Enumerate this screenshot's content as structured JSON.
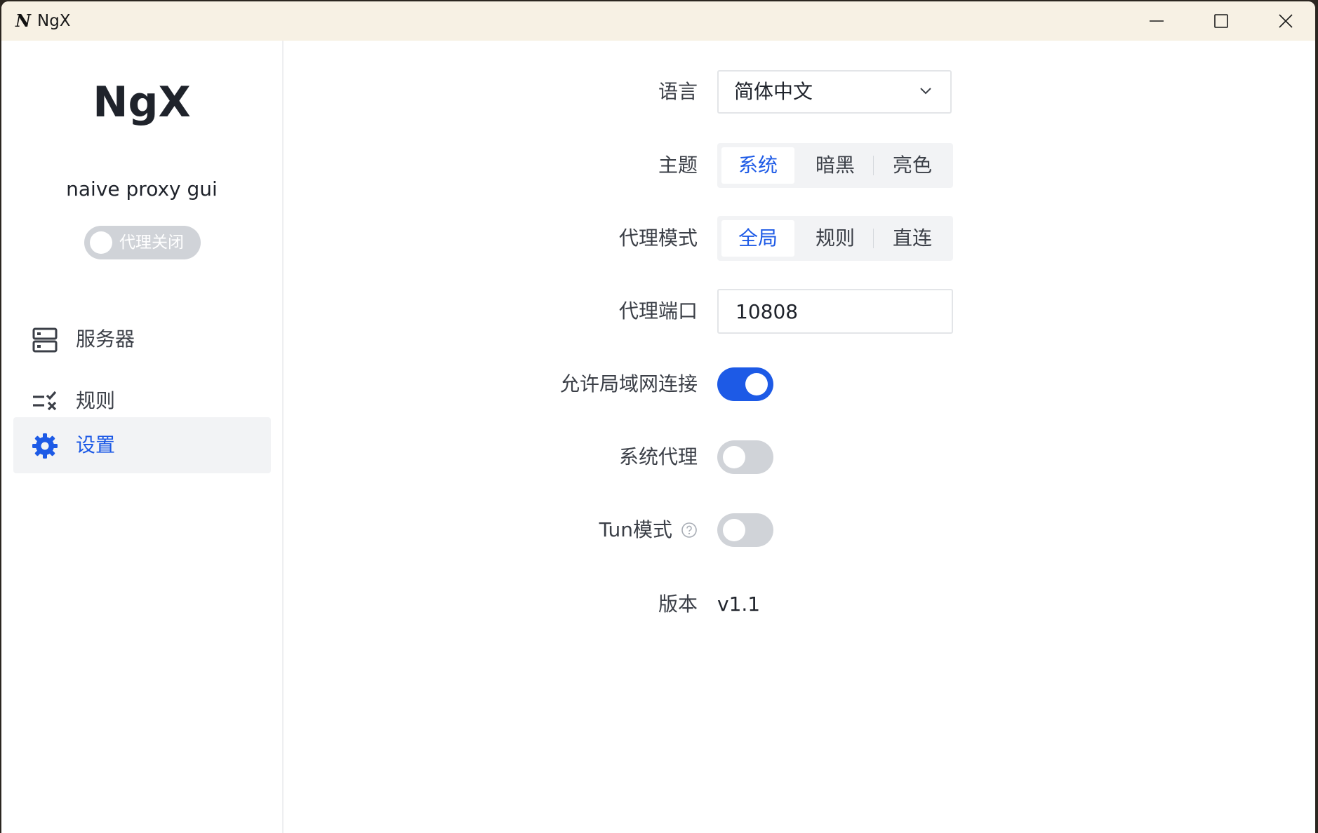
{
  "window": {
    "title": "NgX",
    "app_icon_letter": "N",
    "controls": [
      "minimize-icon",
      "maximize-icon",
      "close-icon"
    ]
  },
  "sidebar": {
    "brand": "NgX",
    "subtitle": "naive proxy gui",
    "proxy_toggle": {
      "label": "代理关闭",
      "on": false
    },
    "items": [
      {
        "label": "服务器",
        "icon": "server-icon",
        "active": false
      },
      {
        "label": "规则",
        "icon": "rules-icon",
        "active": false
      },
      {
        "label": "设置",
        "icon": "gear-icon",
        "active": true
      }
    ]
  },
  "settings": {
    "language": {
      "label": "语言",
      "value": "简体中文"
    },
    "theme": {
      "label": "主题",
      "options": [
        "系统",
        "暗黑",
        "亮色"
      ],
      "selected": "系统"
    },
    "proxy_mode": {
      "label": "代理模式",
      "options": [
        "全局",
        "规则",
        "直连"
      ],
      "selected": "全局"
    },
    "proxy_port": {
      "label": "代理端口",
      "value": "10808"
    },
    "allow_lan": {
      "label": "允许局域网连接",
      "on": true
    },
    "system_proxy": {
      "label": "系统代理",
      "on": false
    },
    "tun_mode": {
      "label": "Tun模式",
      "on": false
    },
    "version": {
      "label": "版本",
      "value": "v1.1"
    }
  },
  "colors": {
    "accent": "#1d5ae6",
    "titlebar": "#f7f1e4",
    "switch_off": "#d0d3d8",
    "active_bg": "#f2f3f5"
  }
}
